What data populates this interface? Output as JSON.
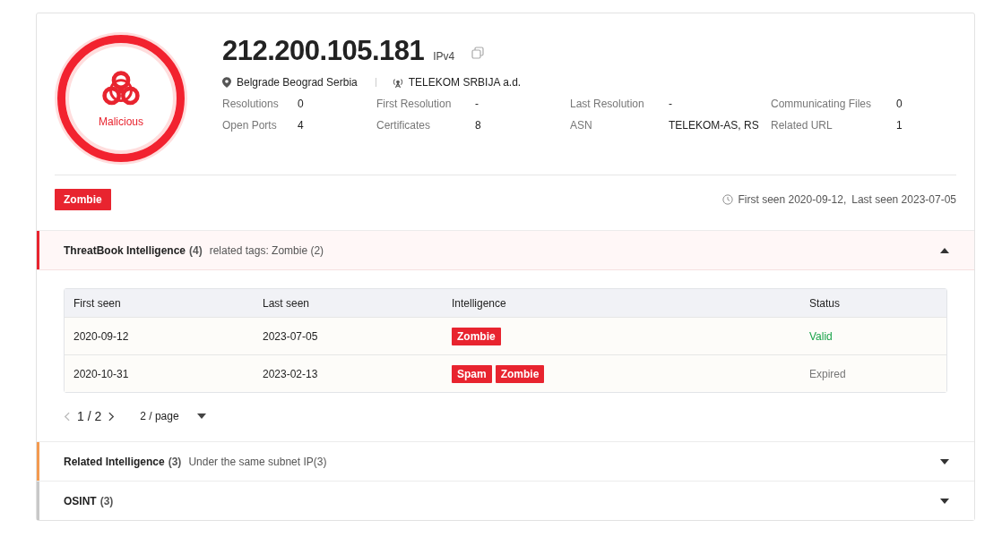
{
  "verdict": {
    "label": "Malicious"
  },
  "ip": {
    "address": "212.200.105.181",
    "version": "IPv4"
  },
  "location": "Belgrade Beograd Serbia",
  "carrier": "TELEKOM SRBIJA a.d.",
  "stats": [
    {
      "label": "Resolutions",
      "value": "0"
    },
    {
      "label": "First Resolution",
      "value": "-"
    },
    {
      "label": "Last Resolution",
      "value": "-"
    },
    {
      "label": "Communicating Files",
      "value": "0"
    },
    {
      "label": "Open Ports",
      "value": "4"
    },
    {
      "label": "Certificates",
      "value": "8"
    },
    {
      "label": "ASN",
      "value": "TELEKOM-AS, RS"
    },
    {
      "label": "Related URL",
      "value": "1"
    }
  ],
  "tags": [
    "Zombie"
  ],
  "seen": {
    "first": "First seen 2020-09-12,",
    "last": "Last seen 2023-07-05"
  },
  "sections": [
    {
      "title": "ThreatBook Intelligence",
      "count": "(4)",
      "note": "related tags: Zombie (2)",
      "color": "#e8242f",
      "expanded": true,
      "table": {
        "columns": [
          "First seen",
          "Last seen",
          "Intelligence",
          "Status"
        ],
        "rows": [
          {
            "first_seen": "2020-09-12",
            "last_seen": "2023-07-05",
            "tags": [
              "Zombie"
            ],
            "status": "Valid",
            "kind": "valid"
          },
          {
            "first_seen": "2020-10-31",
            "last_seen": "2023-02-13",
            "tags": [
              "Spam",
              "Zombie"
            ],
            "status": "Expired",
            "kind": "expired"
          }
        ]
      },
      "pagination": {
        "page": "1 / 2",
        "size": "2 / page"
      }
    },
    {
      "title": "Related Intelligence",
      "count": "(3)",
      "note": "Under the same subnet IP(3)",
      "color": "#f39a4f",
      "expanded": false
    },
    {
      "title": "OSINT",
      "count": "(3)",
      "color": "#c8c8c8",
      "expanded": false
    }
  ]
}
